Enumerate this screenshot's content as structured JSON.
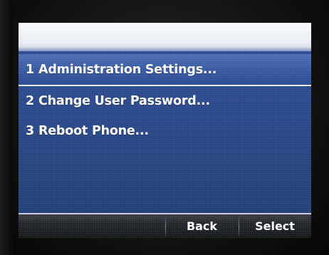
{
  "screen": {
    "title": ""
  },
  "menu": {
    "items": [
      {
        "number": "1",
        "label": "Administration Settings...",
        "selected": true
      },
      {
        "number": "2",
        "label": "Change User Password...",
        "selected": false
      },
      {
        "number": "3",
        "label": "Reboot Phone...",
        "selected": false
      }
    ]
  },
  "softkeys": {
    "slot1": "",
    "slot2": "",
    "back": "Back",
    "select": "Select"
  },
  "colors": {
    "screen_background": "#2b4a8c",
    "selected_row": "#3a5ca4",
    "title_bar": "#f2f3f7",
    "softkey_bar": "#23262c",
    "text": "#ffffff"
  }
}
